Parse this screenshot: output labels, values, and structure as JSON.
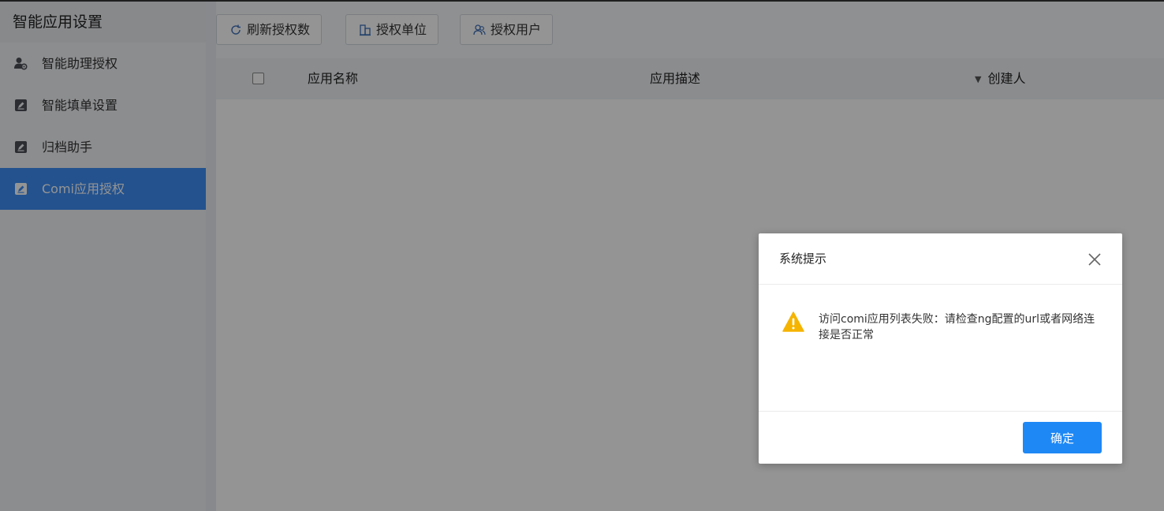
{
  "sidebar": {
    "title": "智能应用设置",
    "items": [
      {
        "label": "智能助理授权",
        "icon": "user-gear-icon",
        "active": false
      },
      {
        "label": "智能填单设置",
        "icon": "edit-icon",
        "active": false
      },
      {
        "label": "归档助手",
        "icon": "edit-icon",
        "active": false
      },
      {
        "label": "Comi应用授权",
        "icon": "edit-icon",
        "active": true
      }
    ]
  },
  "toolbar": {
    "refresh_label": "刷新授权数",
    "units_label": "授权单位",
    "users_label": "授权用户"
  },
  "table": {
    "columns": [
      "应用名称",
      "应用描述",
      "创建人"
    ]
  },
  "dialog": {
    "title": "系统提示",
    "message": "访问comi应用列表失败：请检查ng配置的url或者网络连接是否正常",
    "ok_label": "确定"
  },
  "colors": {
    "accent": "#3d8df5",
    "ok_button": "#1e88f5",
    "warning": "#f5b400"
  }
}
